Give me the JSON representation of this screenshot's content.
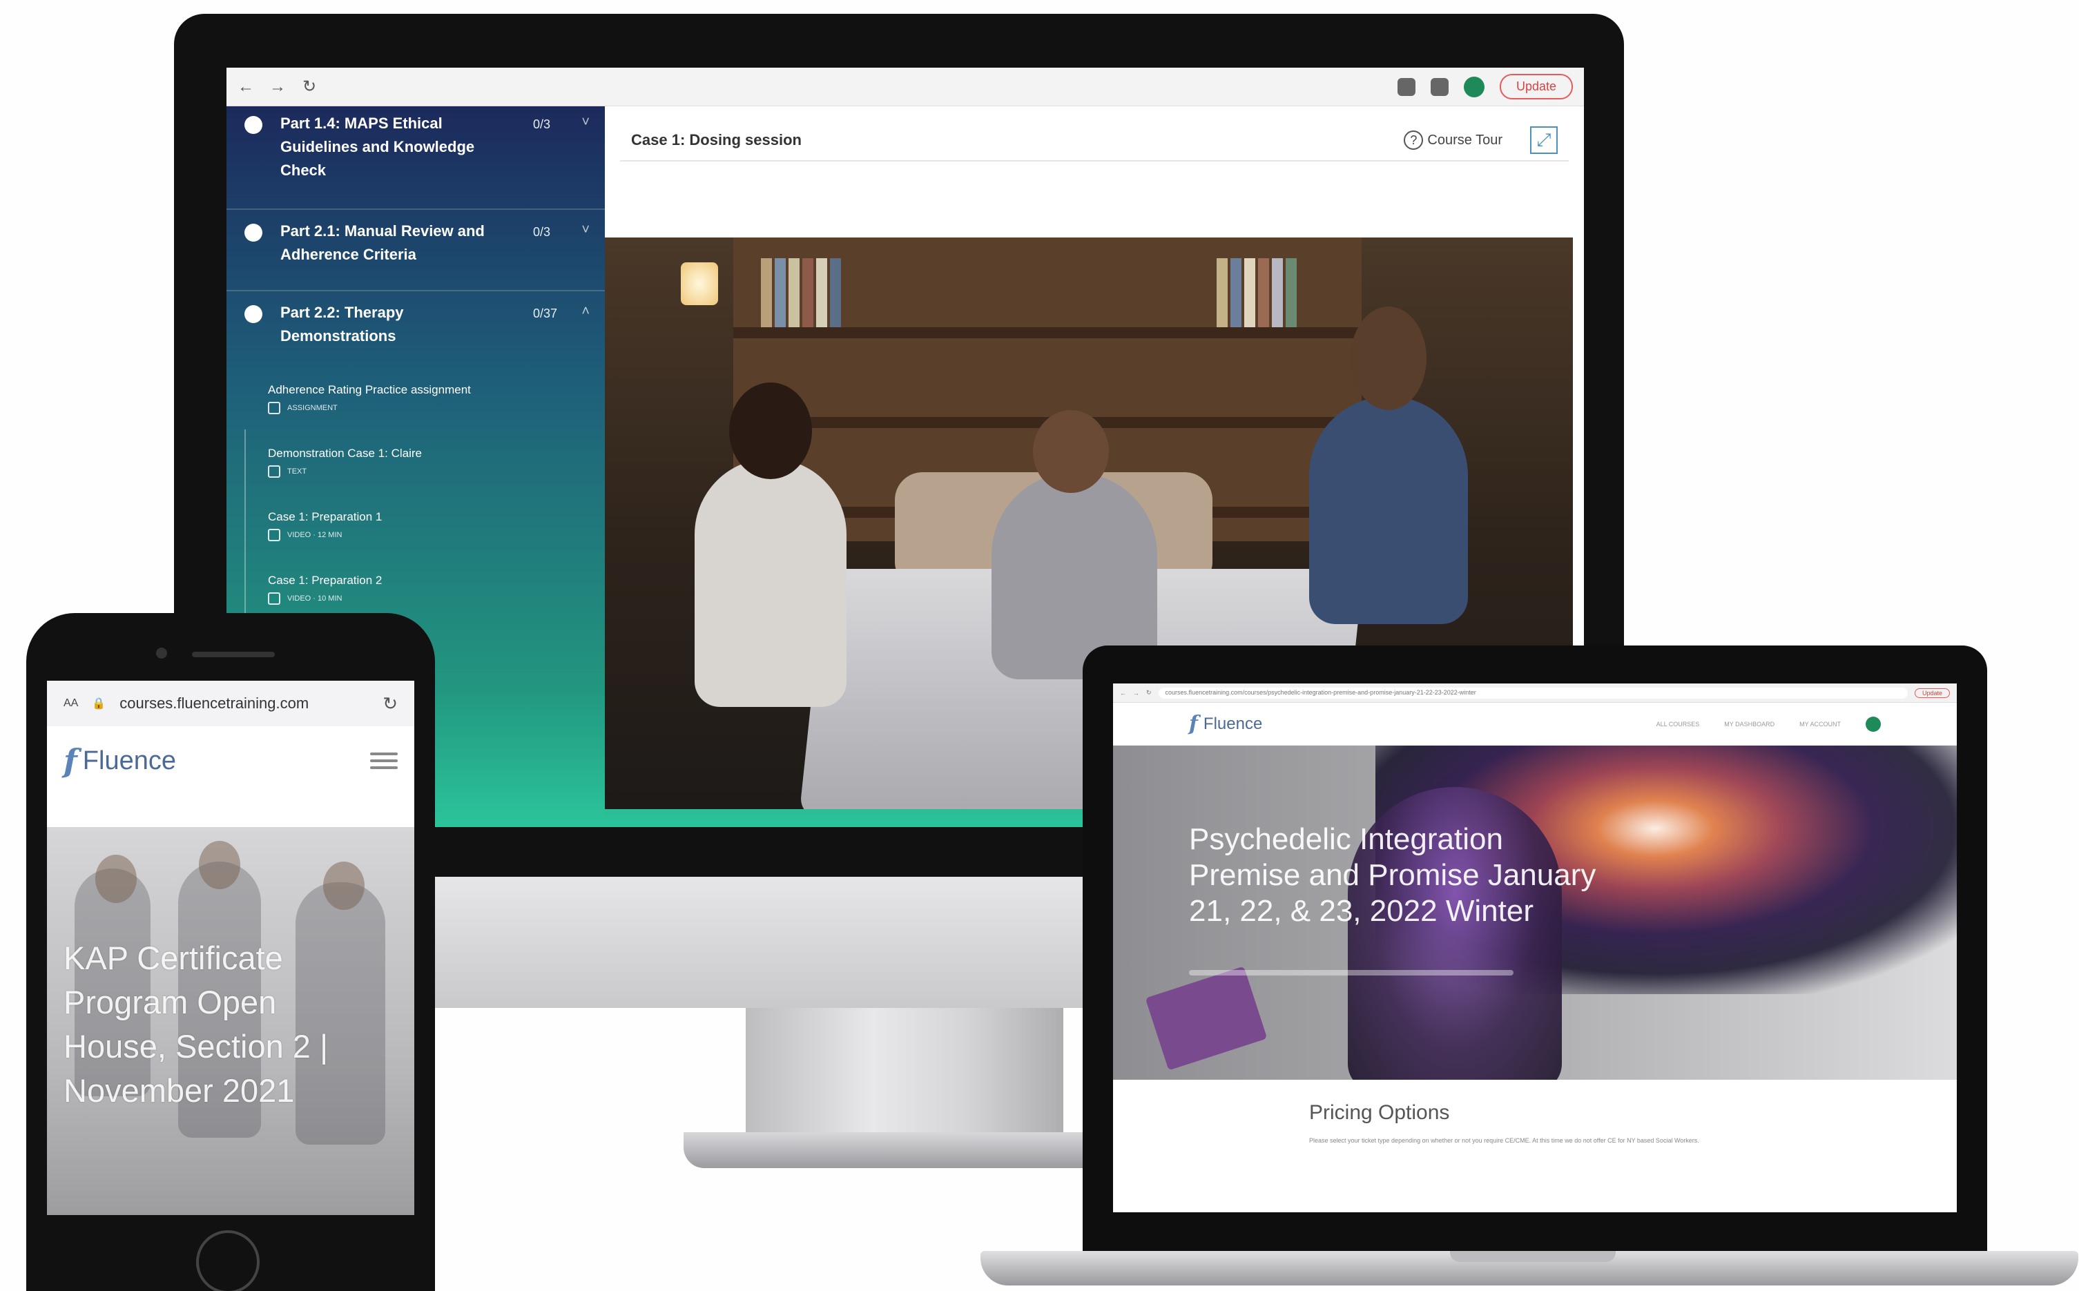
{
  "imac": {
    "browser": {
      "back_glyph": "←",
      "forward_glyph": "→",
      "reload_glyph": "↻",
      "update_label": "Update"
    },
    "sidebar": {
      "modules": [
        {
          "title": "Part 1.4: MAPS Ethical Guidelines and Knowledge Check",
          "count": "0/3",
          "chevron": "˅"
        },
        {
          "title": "Part 2.1: Manual Review and Adherence Criteria",
          "count": "0/3",
          "chevron": "˅"
        },
        {
          "title": "Part 2.2: Therapy Demonstrations",
          "count": "0/37",
          "chevron": "˄"
        }
      ],
      "lessons": [
        {
          "title": "Adherence Rating Practice assignment",
          "meta": "ASSIGNMENT"
        },
        {
          "title": "Demonstration Case 1: Claire",
          "meta": "TEXT"
        },
        {
          "title": "Case 1: Preparation 1",
          "meta": "VIDEO · 12 MIN"
        },
        {
          "title": "Case 1: Preparation 2",
          "meta": "VIDEO · 10 MIN"
        }
      ]
    },
    "content": {
      "title": "Case 1: Dosing session",
      "course_tour_label": "Course Tour",
      "help_glyph": "?",
      "expand_glyph": "⤢"
    }
  },
  "laptop": {
    "browser": {
      "url": "courses.fluencetraining.com/courses/psychedelic-integration-premise-and-promise-january-21-22-23-2022-winter",
      "update_label": "Update"
    },
    "site": {
      "brand": "Fluence",
      "brand_mark": "f",
      "menu": [
        "ALL COURSES",
        "MY DASHBOARD",
        "MY ACCOUNT"
      ]
    },
    "hero_title": "Psychedelic Integration Premise and Promise January 21, 22, & 23, 2022 Winter",
    "pricing_title": "Pricing Options",
    "pricing_text": "Please select your ticket type depending on whether or not you require CE/CME. At this time we do not offer CE for NY based Social Workers."
  },
  "phone": {
    "text_size_label": "AA",
    "lock_glyph": "🔒",
    "url": "courses.fluencetraining.com",
    "reload_glyph": "↻",
    "brand": "Fluence",
    "brand_mark": "f",
    "hero_title": "KAP Certificate Program Open House, Section 2 | November 2021"
  }
}
